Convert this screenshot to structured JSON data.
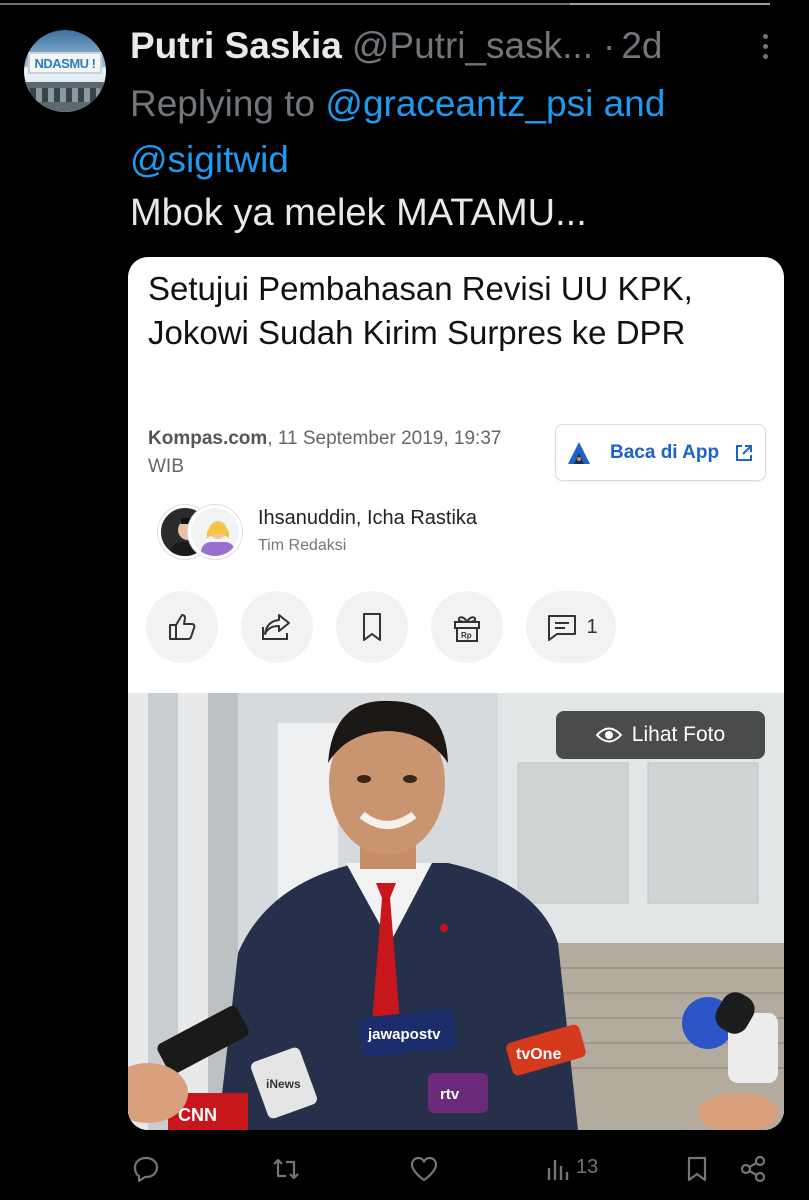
{
  "tweet": {
    "author_name": "Putri Saskia",
    "author_handle": "@Putri_sask...",
    "separator": "·",
    "time": "2d",
    "avatar_sign_text": "NDASMU !",
    "replying_prefix": "Replying to",
    "reply_mentions": [
      "@graceantz_psi",
      "@sigitwid"
    ],
    "reply_joiner": "and",
    "text": "Mbok ya melek MATAMU..."
  },
  "article": {
    "title": "Setujui Pembahasan Revisi UU KPK, Jokowi Sudah Kirim Surpres ke DPR",
    "source": "Kompas.com",
    "date": ", 11 September 2019, 19:37 WIB",
    "app_button_label": "Baca di App",
    "authors": "Ihsanuddin,  Icha Rastika",
    "team": "Tim Redaksi",
    "comment_count": "1",
    "photo_button_label": "Lihat Foto",
    "mic_labels": [
      "jawapostv",
      "tvOne",
      "CNN",
      "iNews",
      "rtv"
    ]
  },
  "footer": {
    "views_count": "13"
  },
  "colors": {
    "background": "#000000",
    "link": "#1d9bf0",
    "muted": "#71767b",
    "app_accent": "#1c63c8"
  }
}
